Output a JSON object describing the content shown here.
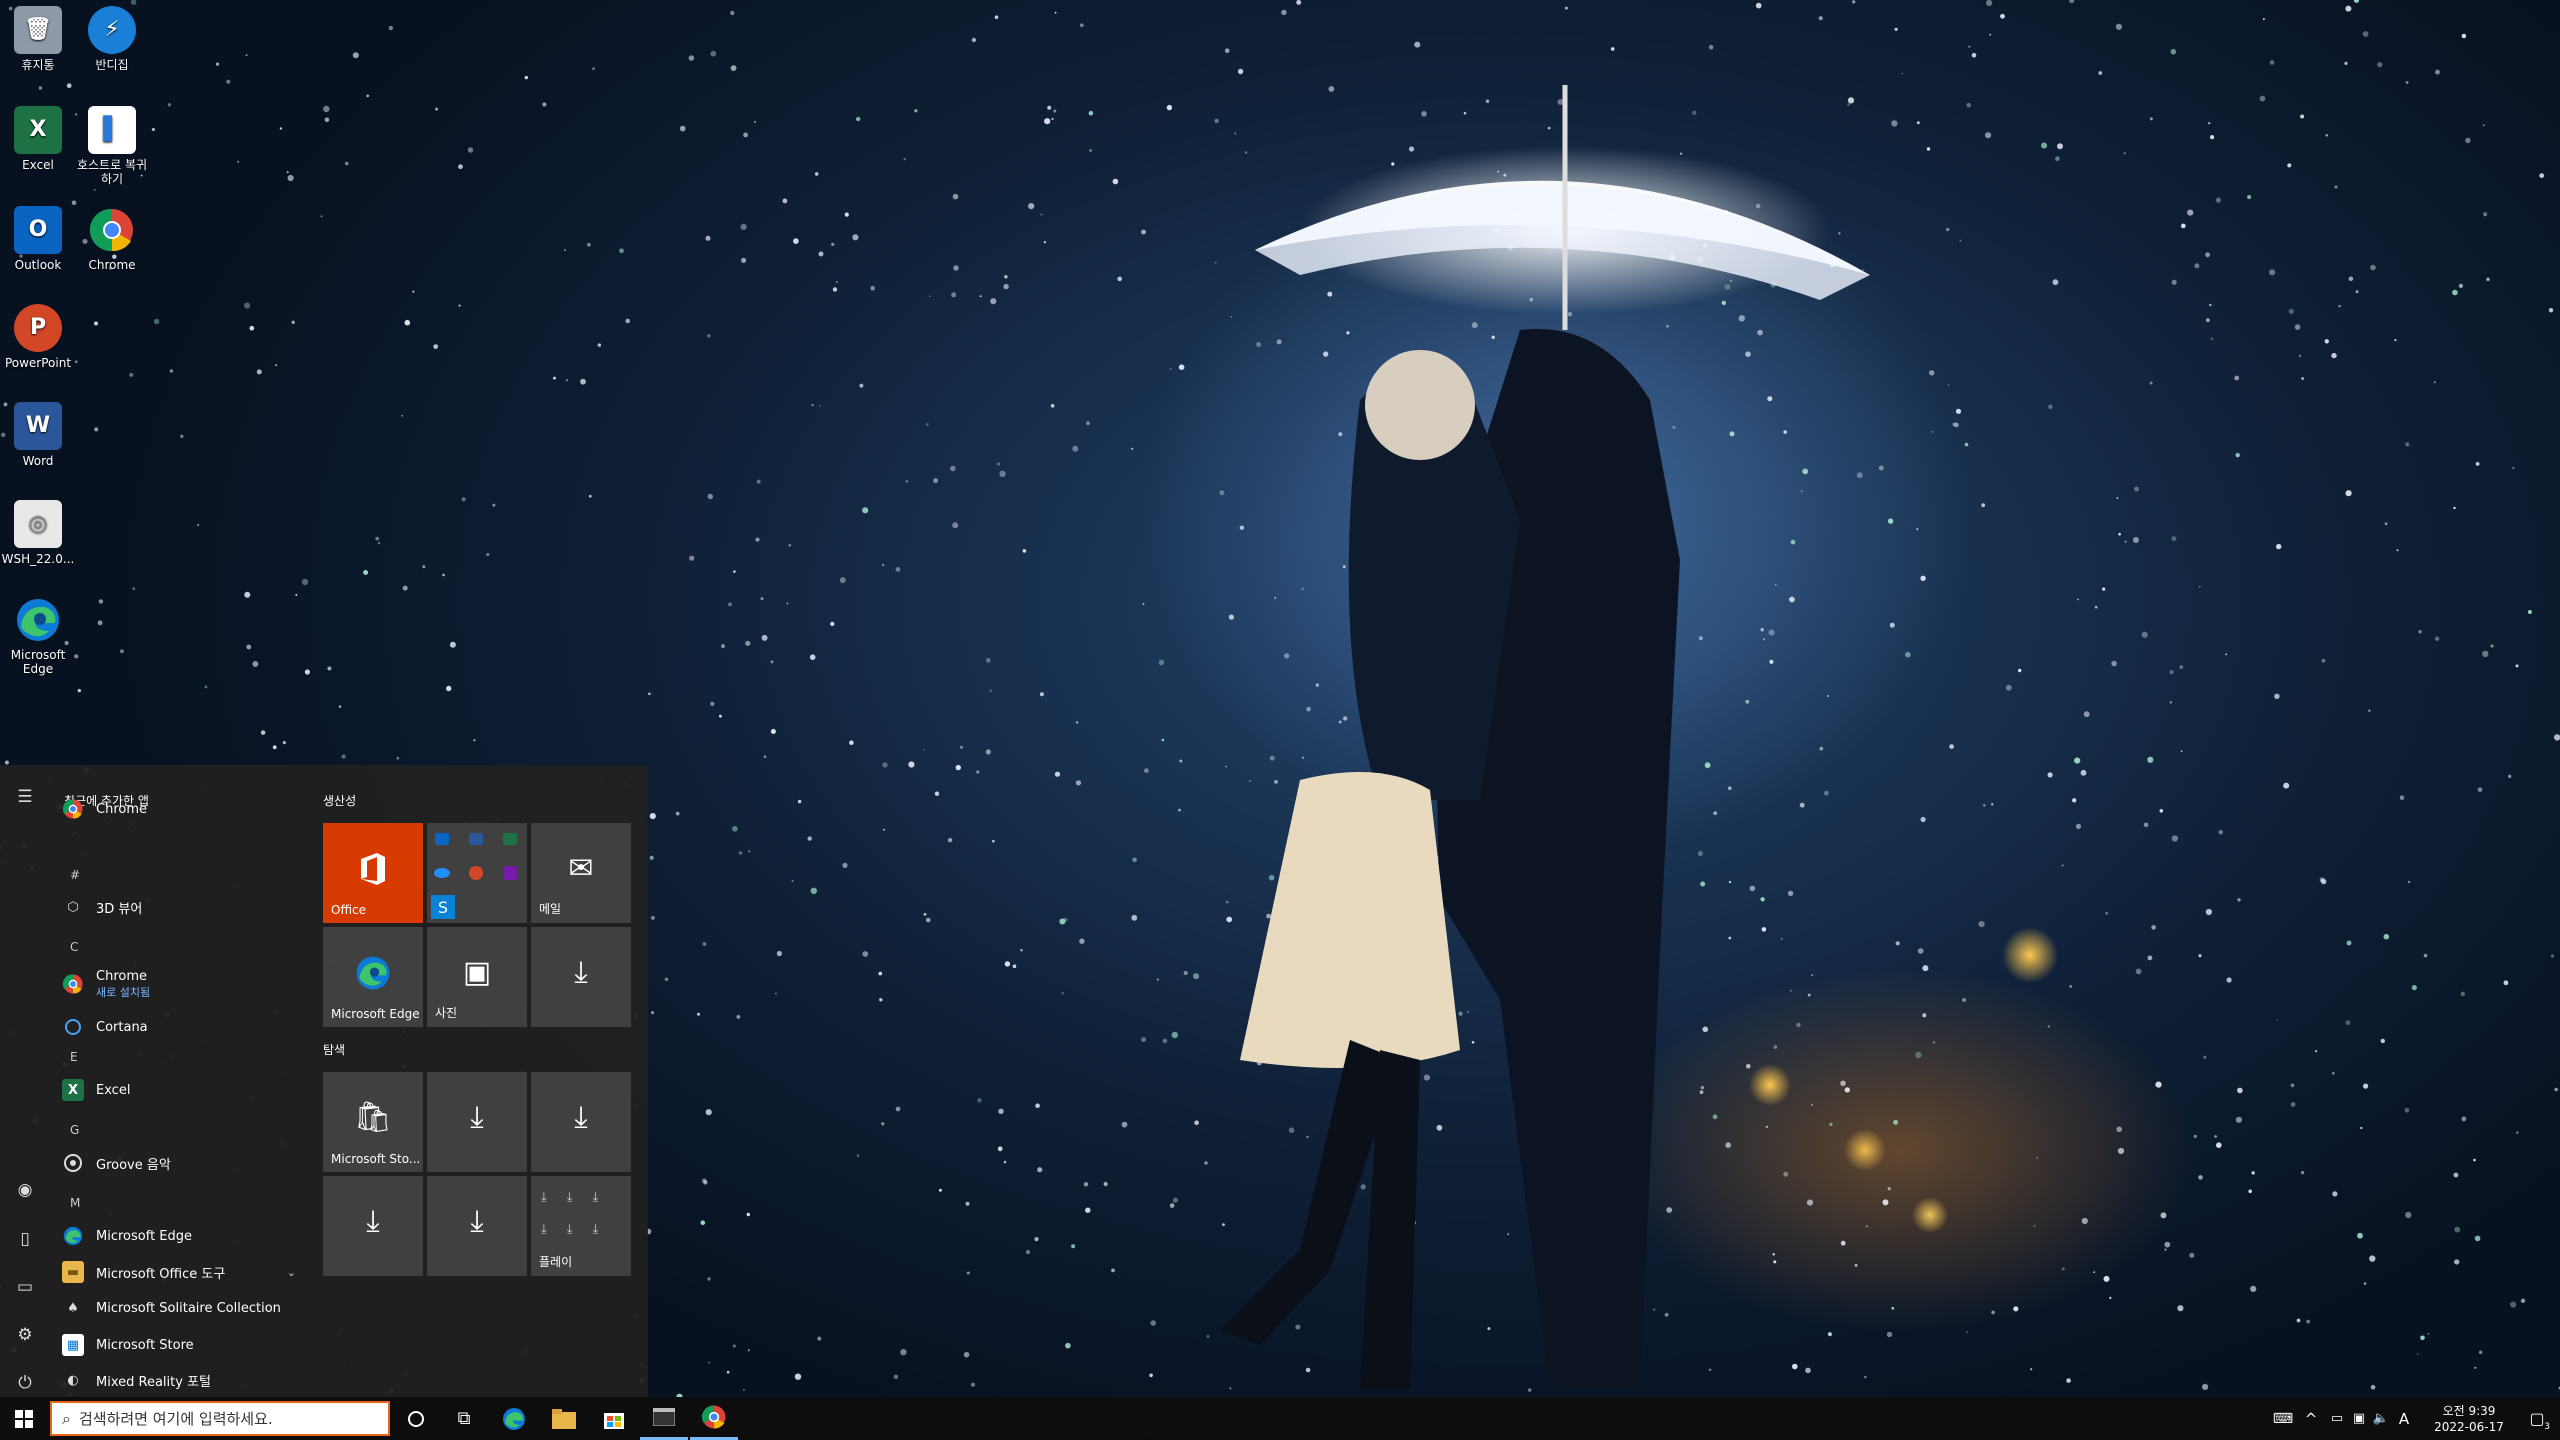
{
  "desktop": {
    "icons": [
      {
        "label": "휴지통",
        "icon": "recycle-bin-icon"
      },
      {
        "label": "반디집",
        "icon": "bandizip-icon"
      },
      {
        "label": "Excel",
        "icon": "excel-icon"
      },
      {
        "label": "호스트로 복귀하기",
        "icon": "host-return-icon"
      },
      {
        "label": "Outlook",
        "icon": "outlook-icon"
      },
      {
        "label": "Chrome",
        "icon": "chrome-icon"
      },
      {
        "label": "PowerPoint",
        "icon": "powerpoint-icon"
      },
      {
        "label": "Word",
        "icon": "word-icon"
      },
      {
        "label": "WSH_22.0...",
        "icon": "disc-image-icon"
      },
      {
        "label": "Microsoft Edge",
        "icon": "edge-icon"
      }
    ]
  },
  "start_menu": {
    "recent_header": "최근에 추가한 앱",
    "letters": [
      "#",
      "C",
      "E",
      "G",
      "M"
    ],
    "apps": [
      {
        "label": "Chrome",
        "icon": "chrome-icon"
      },
      {
        "label": "3D 뷰어",
        "icon": "cube-icon"
      },
      {
        "label": "Chrome",
        "sub": "새로 설치됨",
        "icon": "chrome-icon"
      },
      {
        "label": "Cortana",
        "icon": "cortana-icon"
      },
      {
        "label": "Excel",
        "icon": "excel-icon"
      },
      {
        "label": "Groove 음악",
        "icon": "groove-icon"
      },
      {
        "label": "Microsoft Edge",
        "icon": "edge-icon"
      },
      {
        "label": "Microsoft Office 도구",
        "icon": "folder-icon"
      },
      {
        "label": "Microsoft Solitaire Collection",
        "icon": "cards-icon"
      },
      {
        "label": "Microsoft Store",
        "icon": "store-icon"
      },
      {
        "label": "Mixed Reality 포털",
        "icon": "headset-icon"
      }
    ],
    "groups": {
      "productivity": "생산성",
      "explore": "탐색"
    },
    "tiles": {
      "office": "Office",
      "mail": "메일",
      "edge": "Microsoft Edge",
      "photos": "사진",
      "store": "Microsoft Sto...",
      "play": "플레이"
    }
  },
  "taskbar": {
    "search_placeholder": "검색하려면 여기에 입력하세요.",
    "clock_time": "오전 9:39",
    "clock_date": "2022-06-17",
    "ime": "A",
    "notification_count": "3"
  },
  "colors": {
    "office_tile": "#d83b01",
    "search_border": "#e8641b",
    "accent_sub": "#7ab8ff"
  }
}
